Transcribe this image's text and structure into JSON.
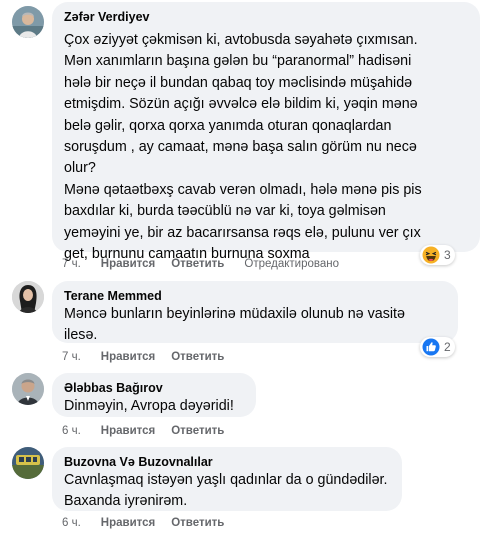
{
  "comments": [
    {
      "author": "Zəfər Verdiyev",
      "text": "Çox əziyyət çəkmisən ki, avtobusda səyahətə çıxmısan.\nMən xanımların başına gələn bu “paranormal” hadisəni\nhələ bir neçə il bundan qabaq toy məclisində müşahidə\netmişdim. Sözün açığı əvvəlcə elə bildim ki, yəqin mənə\nbelə gəlir, qorxa qorxa yanımda oturan qonaqlardan\nsoruşdum , ay camaat, mənə başa salın görüm nu necə\nolur?\nMənə qətaətbəxş cavab verən olmadı, hələ mənə pis pis\nbaxdılar ki, burda təəcüblü nə var ki, toya gəlmisən\nyeməyini ye, bir az bacarırsansa rəqs elə, pulunu ver çıx\nget, burnunu camaatın burnuna soxma",
      "time": "7 ч.",
      "like_label": "Нравится",
      "reply_label": "Ответить",
      "edited_label": "Отредактировано",
      "reaction": {
        "icon": "haha-reaction-icon",
        "count": "3"
      }
    },
    {
      "author": "Terane Memmed",
      "text": "Məncə bunların beyinlərinə müdaxilə olunub nə vasitə\nilesə.",
      "time": "7 ч.",
      "like_label": "Нравится",
      "reply_label": "Ответить",
      "reaction": {
        "icon": "like-reaction-icon",
        "count": "2"
      }
    },
    {
      "author": "Ələbbas Bağırov",
      "text": "Dinməyin, Avropa dəyəridi!",
      "time": "6 ч.",
      "like_label": "Нравится",
      "reply_label": "Ответить"
    },
    {
      "author": "Buzovna Və Buzovnalılar",
      "text": "Cavnlaşmaq istəyən yaşlı qadınlar da o gündədilər.\nBaxanda iyrənirəm.",
      "time": "6 ч.",
      "like_label": "Нравится",
      "reply_label": "Ответить"
    }
  ],
  "colors": {
    "bubble_bg": "#f0f2f5",
    "meta_text": "#65676b",
    "like_blue": "#1877f2",
    "haha_yellow": "#f7b125"
  }
}
